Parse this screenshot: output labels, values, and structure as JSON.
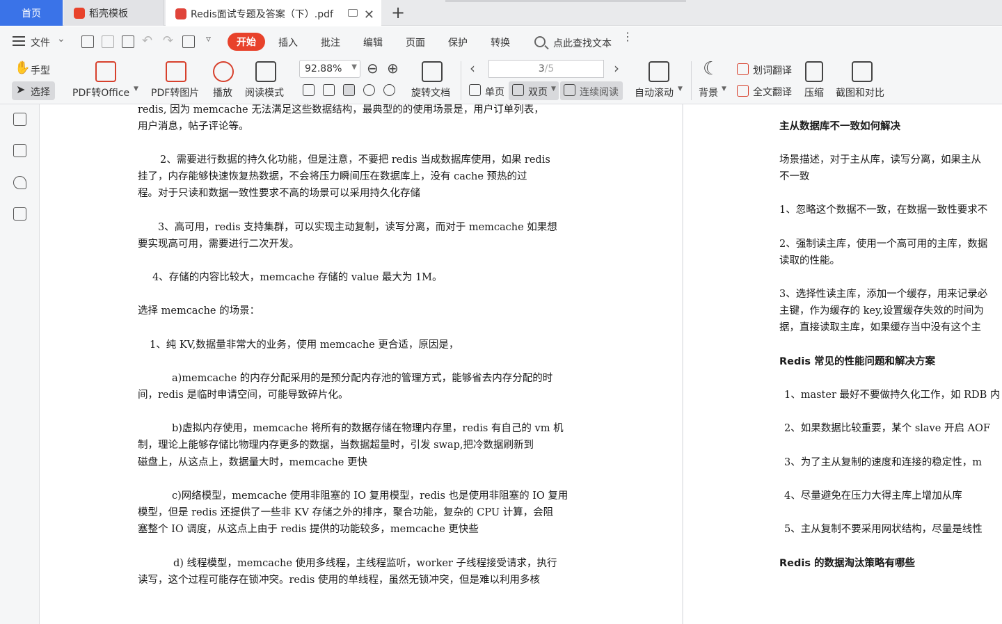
{
  "tabs": {
    "home": "首页",
    "template": "稻壳模板",
    "document": "Redis面试专题及答案（下）.pdf"
  },
  "menu": {
    "file": "文件",
    "start": "开始",
    "insert": "插入",
    "annotate": "批注",
    "edit": "编辑",
    "page": "页面",
    "protect": "保护",
    "convert": "转换",
    "find_text": "点此查找文本"
  },
  "ribbon": {
    "hand": "手型",
    "select": "选择",
    "pdf_to_office": "PDF转Office",
    "pdf_to_image": "PDF转图片",
    "play": "播放",
    "read_mode": "阅读模式",
    "zoom": "92.88%",
    "rotate_doc": "旋转文档",
    "single_page": "单页",
    "double_page": "双页",
    "continuous": "连续阅读",
    "page_current": "3",
    "page_total": "/5",
    "auto_scroll": "自动滚动",
    "background": "背景",
    "word_translate": "划词翻译",
    "full_translate": "全文翻译",
    "compress": "压缩",
    "screenshot_compare": "截图和对比"
  },
  "left_page": {
    "lines": [
      "redis,     因为 memcache 无法满足这些数据结构，最典型的的使用场景是，用户订单列表，",
      "用户消息，帖子评论等。",
      "2、需要进行数据的持久化功能，但是注意，不要把 redis 当成数据库使用，如果 redis",
      "挂了，内存能够快速恢复热数据，不会将压力瞬间压在数据库上，没有 cache 预热的过",
      "程。对于只读和数据一致性要求不高的场景可以采用持久化存储",
      "3、高可用，redis 支持集群，可以实现主动复制，读写分离，而对于 memcache 如果想",
      "要实现高可用，需要进行二次开发。",
      "4、存储的内容比较大，memcache 存储的 value 最大为 1M。",
      "选择 memcache 的场景：",
      "1、纯 KV,数据量非常大的业务，使用 memcache 更合适，原因是，",
      "a)memcache 的内存分配采用的是预分配内存池的管理方式，能够省去内存分配的时",
      "间，redis 是临时申请空间，可能导致碎片化。",
      "b)虚拟内存使用，memcache 将所有的数据存储在物理内存里，redis 有自己的 vm 机",
      "制，理论上能够存储比物理内存更多的数据，当数据超量时，引发 swap,把冷数据刷新到",
      "磁盘上，从这点上，数据量大时，memcache 更快",
      "c)网络模型，memcache 使用非阻塞的 IO 复用模型，redis 也是使用非阻塞的 IO 复用",
      "模型，但是 redis 还提供了一些非 KV 存储之外的排序，聚合功能，复杂的 CPU 计算，会阻",
      "塞整个 IO 调度，从这点上由于 redis 提供的功能较多，memcache 更快些",
      "d)  线程模型，memcache 使用多线程，主线程监听，worker 子线程接受请求，执行",
      "读写，这个过程可能存在锁冲突。redis 使用的单线程，虽然无锁冲突，但是难以利用多核"
    ]
  },
  "right_page": {
    "lines": [
      "主从数据库不一致如何解决",
      "场景描述，对于主从库，读写分离，如果主从",
      "不一致",
      "1、忽略这个数据不一致，在数据一致性要求不",
      "2、强制读主库，使用一个高可用的主库，数据",
      "读取的性能。",
      "3、选择性读主库，添加一个缓存，用来记录必",
      "主键，作为缓存的 key,设置缓存失效的时间为",
      "据，直接读取主库，如果缓存当中没有这个主",
      "Redis 常见的性能问题和解决方案",
      "1、master 最好不要做持久化工作，如 RDB 内",
      "2、如果数据比较重要，某个 slave 开启 AOF",
      "3、为了主从复制的速度和连接的稳定性，m",
      "4、尽量避免在压力大得主库上增加从库",
      "5、主从复制不要采用网状结构，尽量是线性",
      "Redis 的数据淘汰策略有哪些"
    ]
  },
  "colors": {
    "accent_blue": "#3a73e8",
    "brand_red": "#e8422b"
  }
}
